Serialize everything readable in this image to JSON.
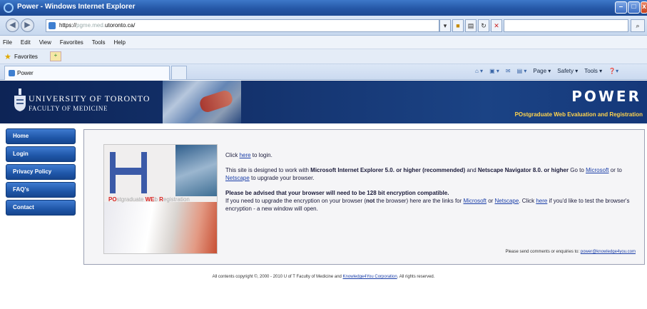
{
  "window": {
    "title": "Power - Windows Internet Explorer",
    "buttons": {
      "minimize": "–",
      "maximize": "□",
      "close": "x"
    }
  },
  "addressbar": {
    "url_prefix": "https://",
    "url_dim": "pgme.med.",
    "url_main": "utoronto.ca/",
    "search_icon": "search-icon"
  },
  "menu": [
    "File",
    "Edit",
    "View",
    "Favorites",
    "Tools",
    "Help"
  ],
  "favorites": {
    "label": "Favorites"
  },
  "tab": {
    "title": "Power"
  },
  "command_bar": [
    "Page ▾",
    "Safety ▾",
    "Tools ▾"
  ],
  "header": {
    "university": "UNIVERSITY OF TORONTO",
    "faculty": "FACULTY OF MEDICINE",
    "app_title": "POWER",
    "app_subtitle": "POstgraduate Web Evaluation and Registration"
  },
  "sidebar": {
    "items": [
      {
        "label": "Home"
      },
      {
        "label": "Login"
      },
      {
        "label": "Privacy Policy"
      },
      {
        "label": "FAQ's"
      },
      {
        "label": "Contact"
      }
    ]
  },
  "logo_tagline": {
    "p1": "PO",
    "p2": "stgraduate ",
    "p3": "WE",
    "p4": "b ",
    "p5": "R",
    "p6": "egistration"
  },
  "content": {
    "login_pre": "Click ",
    "login_link": "here",
    "login_post": " to login.",
    "browser_line1": "This site is designed to work with ",
    "browser_ie": "Microsoft Internet Explorer 5.0. or higher (recommended)",
    "browser_and": " and ",
    "browser_ns": "Netscape Navigator 8.0. or higher",
    "browser_goto": " Go to ",
    "link_microsoft": "Microsoft",
    "browser_or": " or to ",
    "link_netscape": "Netscape",
    "browser_upgrade": " to upgrade your browser.",
    "enc_pre": "Please be advised that your ",
    "enc_browser": "browser",
    "enc_mid": " will need to be ",
    "enc_bits": "128 bit encryption compatible",
    "enc_end": ".",
    "upg_pre": "If you need to upgrade the encryption on your browser (",
    "upg_not": "not",
    "upg_mid": " the browser) here are the links for ",
    "upg_ms": "Microsoft",
    "upg_or": " or ",
    "upg_ns": "Netscape",
    "upg_click": ". Click ",
    "upg_here": "here",
    "upg_end": " if you'd like to test the browser's encryption - a new window will open.",
    "feedback_pre": "Please send comments or enquiries to: ",
    "feedback_email": "power@knowledge4you.com"
  },
  "footer": {
    "pre": "All contents copyright ©, 2000 - 2010 U of T Faculty of Medicine and ",
    "link": "Knowledge4You Corporation",
    "post": ". All rights reserved."
  }
}
